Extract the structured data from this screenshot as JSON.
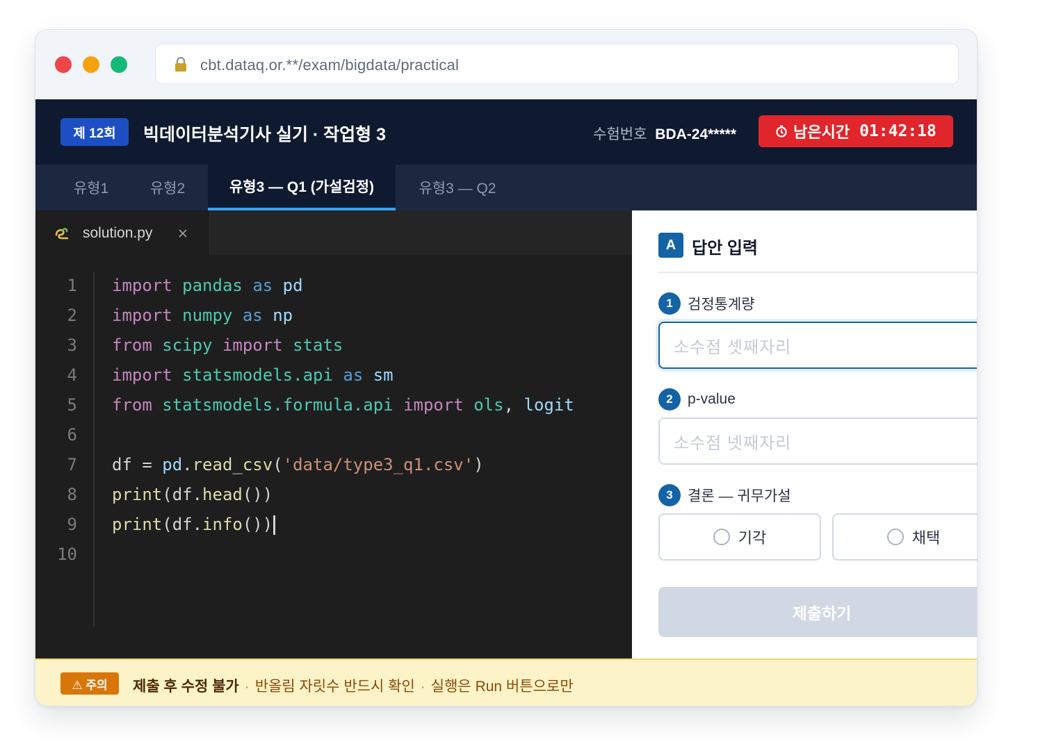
{
  "browser": {
    "url": "cbt.dataq.or.**/exam/bigdata/practical"
  },
  "header": {
    "round_badge": "제 12회",
    "title": "빅데이터분석기사 실기 · 작업형 3",
    "examinee_label": "수험번호",
    "examinee_id": "BDA-24*****",
    "timer_label": "남은시간",
    "timer_value": "01:42:18",
    "timer_color": "#e0262b"
  },
  "tabs": [
    {
      "label": "유형1",
      "active": false
    },
    {
      "label": "유형2",
      "active": false
    },
    {
      "label": "유형3 — Q1 (가설검정)",
      "active": true
    },
    {
      "label": "유형3 — Q2",
      "active": false
    }
  ],
  "editor": {
    "file_name": "solution.py",
    "file_icon": "python-icon",
    "line_numbers": [
      "1",
      "2",
      "3",
      "4",
      "5",
      "6",
      "7",
      "8",
      "9",
      "10"
    ],
    "lines": [
      "import pandas as pd",
      "import numpy as np",
      "from scipy import stats",
      "import statsmodels.api as sm",
      "from statsmodels.formula.api import ols, logit",
      "",
      "df = pd.read_csv('data/type3_q1.csv')",
      "print(df.head())",
      "print(df.info())",
      ""
    ]
  },
  "answer": {
    "badge": "A",
    "title": "답안 입력",
    "questions": [
      {
        "num": "1",
        "label": "검정통계량",
        "placeholder": "소수점 셋째자리"
      },
      {
        "num": "2",
        "label": "p-value",
        "placeholder": "소수점 넷째자리"
      },
      {
        "num": "3",
        "label": "결론 — 귀무가설",
        "options": [
          "기각",
          "채택"
        ]
      }
    ],
    "submit_label": "제출하기"
  },
  "warning": {
    "badge": "⚠ 주의",
    "strong": "제출 후 수정 불가",
    "items": [
      "반올림 자릿수 반드시 확인",
      "실행은 Run 버튼으로만"
    ]
  }
}
